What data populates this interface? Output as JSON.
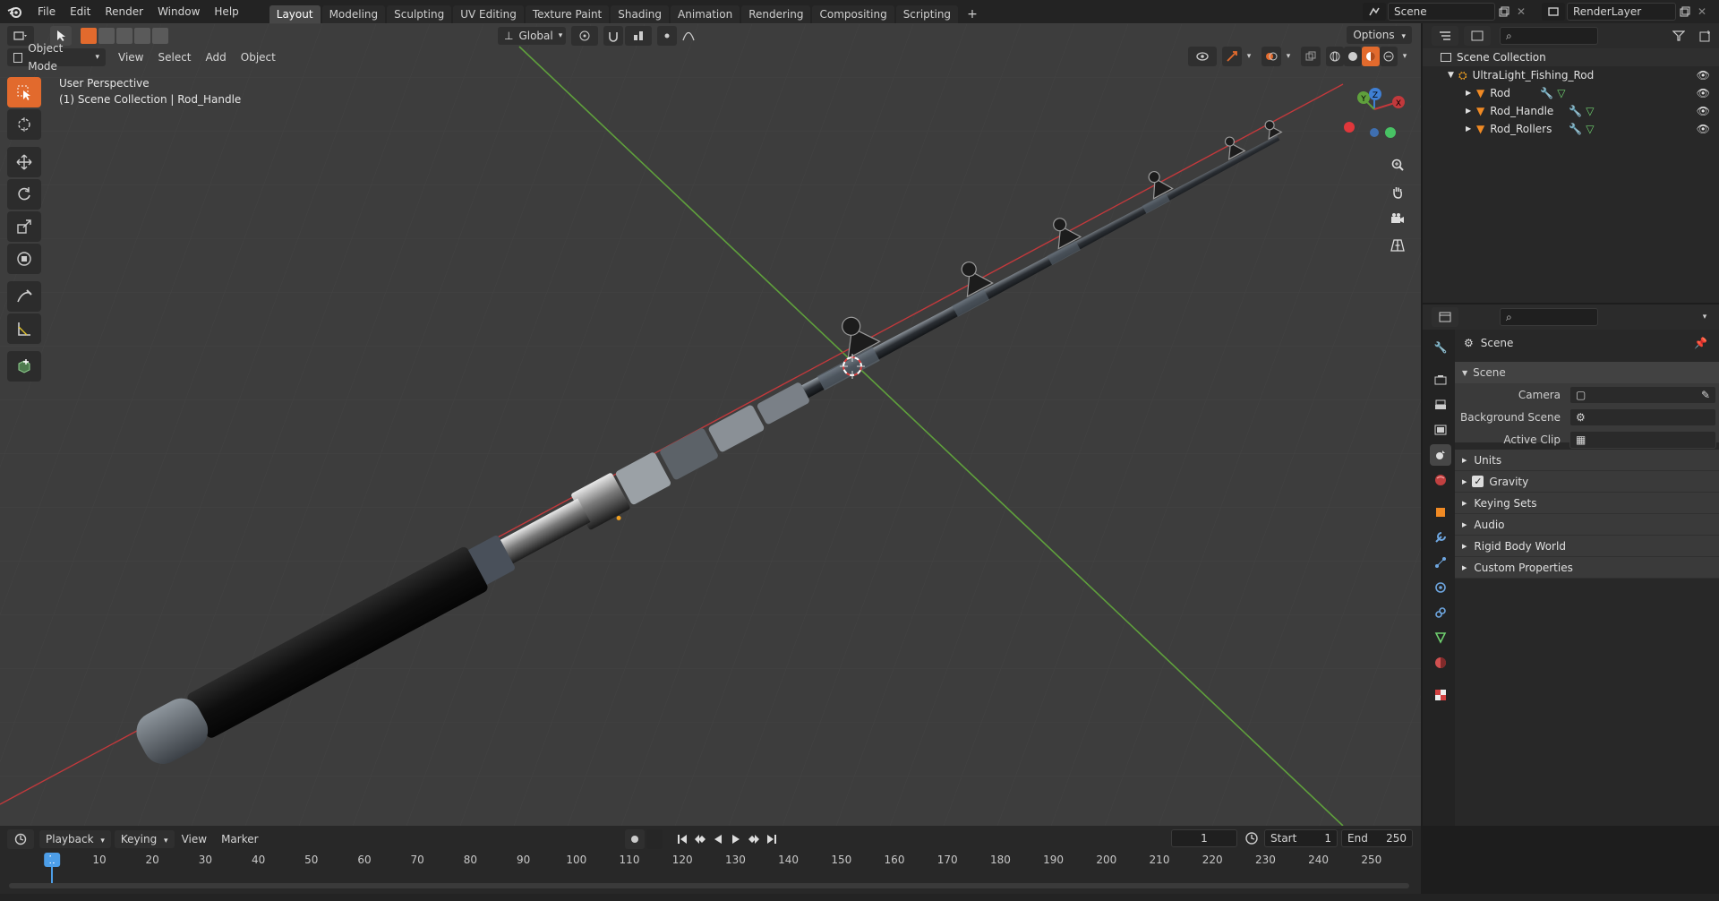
{
  "menu": [
    "File",
    "Edit",
    "Render",
    "Window",
    "Help"
  ],
  "workspaces": [
    {
      "label": "Layout",
      "active": true
    },
    {
      "label": "Modeling"
    },
    {
      "label": "Sculpting"
    },
    {
      "label": "UV Editing"
    },
    {
      "label": "Texture Paint"
    },
    {
      "label": "Shading"
    },
    {
      "label": "Animation"
    },
    {
      "label": "Rendering"
    },
    {
      "label": "Compositing"
    },
    {
      "label": "Scripting"
    }
  ],
  "topright": {
    "scene": "Scene",
    "render_layer": "RenderLayer"
  },
  "viewport": {
    "mode": "Object Mode",
    "menus": [
      "View",
      "Select",
      "Add",
      "Object"
    ],
    "transform_orientation": "Global",
    "options_label": "Options",
    "overlay_line1": "User Perspective",
    "overlay_line2": "(1) Scene Collection | Rod_Handle",
    "axis_labels": {
      "x": "X",
      "y": "Y",
      "z": "Z"
    }
  },
  "outliner": {
    "root": "Scene Collection",
    "collection": "UltraLight_Fishing_Rod",
    "objects": [
      "Rod",
      "Rod_Handle",
      "Rod_Rollers"
    ]
  },
  "properties": {
    "breadcrumb": "Scene",
    "panel_title": "Scene",
    "fields": [
      {
        "label": "Camera"
      },
      {
        "label": "Background Scene"
      },
      {
        "label": "Active Clip"
      }
    ],
    "subpanels": [
      "Units",
      "Gravity",
      "Keying Sets",
      "Audio",
      "Rigid Body World",
      "Custom Properties"
    ]
  },
  "timeline": {
    "menus": [
      "Playback",
      "Keying",
      "View",
      "Marker"
    ],
    "current_frame": "1",
    "start_label": "Start",
    "start": "1",
    "end_label": "End",
    "end": "250",
    "ticks": [
      "1",
      "10",
      "20",
      "30",
      "40",
      "50",
      "60",
      "70",
      "80",
      "90",
      "100",
      "110",
      "120",
      "130",
      "140",
      "150",
      "160",
      "170",
      "180",
      "190",
      "200",
      "210",
      "220",
      "230",
      "240",
      "250"
    ]
  },
  "colors": {
    "accent": "#e26a2d",
    "x_axis": "#c2393c",
    "y_axis": "#5fa03c",
    "selection_orange": "#f08a24"
  }
}
